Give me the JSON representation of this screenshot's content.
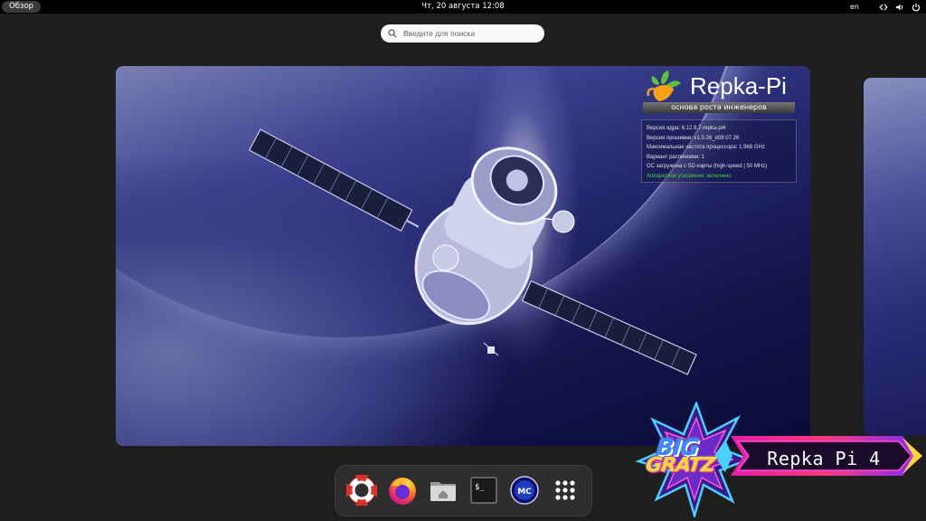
{
  "topbar": {
    "overview_label": "Обзор",
    "clock": "Чт, 20 августа  12:08",
    "language": "en",
    "tray_icons": [
      "network-icon",
      "volume-icon",
      "power-icon"
    ]
  },
  "search": {
    "placeholder": "Введите для поиска"
  },
  "wallpaper": {
    "logo_title": "Repka-Pi",
    "logo_subtitle": "основа роста инженеров",
    "info_lines": [
      "Версия ядра: 6.12.9.7-repka-pi4",
      "Версия прошивки: v1.0.26_d08.07.26",
      "Максимальная частота процессора: 1.968 GHz",
      "Вариант распиновки: 1",
      "ОС загружена с SD-карты (high-speed | 50 MHz)",
      "Аппаратное ускорение: включено"
    ]
  },
  "dock": {
    "apps": [
      {
        "name": "help",
        "icon": "lifebuoy-icon"
      },
      {
        "name": "firefox",
        "icon": "firefox-icon"
      },
      {
        "name": "files",
        "icon": "home-folder-icon"
      },
      {
        "name": "terminal",
        "icon": "terminal-icon",
        "glyph": "$_"
      },
      {
        "name": "midnight-commander",
        "icon": "mc-icon",
        "glyph": "MC"
      },
      {
        "name": "app-grid",
        "icon": "app-grid-icon"
      }
    ]
  },
  "badge": {
    "big": "BIG",
    "gratz": "GRATZ",
    "text": "Repka Pi 4"
  },
  "colors": {
    "topbar_bg": "#000000",
    "desktop_bg": "#1e1e1e",
    "accent_green": "#48d24a",
    "dock_bg": "#2e2e2e"
  }
}
